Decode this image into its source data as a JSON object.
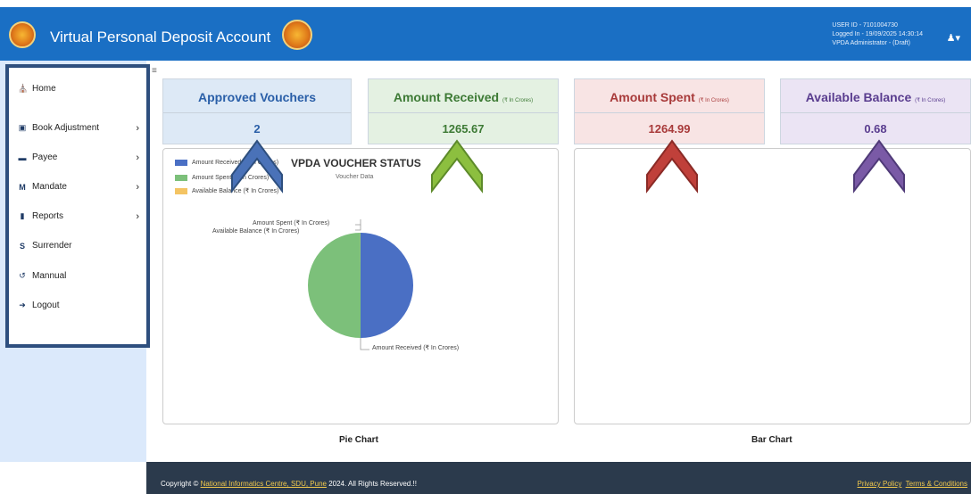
{
  "header": {
    "title": "Virtual Personal Deposit Account",
    "user_id": "USER ID - 7101004730",
    "logged_in": "Logged In - 19/09/2025 14:30:14",
    "role": "VPDA Administrator  -  (Draft)"
  },
  "sidebar": {
    "items": [
      {
        "label": "Home",
        "icon": "home-icon"
      },
      {
        "label": "Book Adjustment",
        "icon": "book-icon"
      },
      {
        "label": "Payee",
        "icon": "payee-icon"
      },
      {
        "label": "Mandate",
        "icon": "mandate-icon"
      },
      {
        "label": "Reports",
        "icon": "reports-icon"
      },
      {
        "label": "Surrender",
        "icon": "surrender-icon"
      },
      {
        "label": "Mannual",
        "icon": "manual-icon"
      },
      {
        "label": "Logout",
        "icon": "logout-icon"
      }
    ]
  },
  "cards": [
    {
      "title": "Approved Vouchers",
      "sub": "",
      "value": "2",
      "color": "#2a5fa8",
      "bg": "#dde9f6"
    },
    {
      "title": "Amount Received",
      "sub": "(₹ In Crores)",
      "value": "1265.67",
      "color": "#3d7a35",
      "bg": "#e4f1e2"
    },
    {
      "title": "Amount Spent",
      "sub": "(₹ In Crores)",
      "value": "1264.99",
      "color": "#a83a3a",
      "bg": "#f8e4e4"
    },
    {
      "title": "Available Balance",
      "sub": "(₹ In Crores)",
      "value": "0.68",
      "color": "#5a3d8f",
      "bg": "#ebe4f4"
    }
  ],
  "pie": {
    "title": "VPDA VOUCHER STATUS",
    "subtitle": "Voucher Data",
    "caption": "Pie Chart",
    "legend": [
      {
        "label": "Amount Received (₹ In Crores)",
        "color": "#4a6fc4"
      },
      {
        "label": "Amount Spent (₹ In Crores)",
        "color": "#7cc07a"
      },
      {
        "label": "Available Balance (₹ In Crores)",
        "color": "#f4c463"
      }
    ],
    "labels": {
      "spent": "Amount Spent (₹ In Crores)",
      "balance": "Available Balance (₹ In Crores)",
      "received": "Amount Received (₹ In Crores)"
    }
  },
  "bar": {
    "caption": "Bar Chart"
  },
  "chart_data": {
    "type": "pie",
    "title": "VPDA VOUCHER STATUS",
    "subtitle": "Voucher Data",
    "categories": [
      "Amount Received (₹ In Crores)",
      "Amount Spent (₹ In Crores)",
      "Available Balance (₹ In Crores)"
    ],
    "values": [
      1265.67,
      1264.99,
      0.68
    ],
    "colors": [
      "#4a6fc4",
      "#7cc07a",
      "#f4c463"
    ],
    "legend_position": "top-left"
  },
  "footer": {
    "prefix": "Copyright © ",
    "org": "National Informatics Centre, SDU, Pune",
    "suffix": " 2024. All Rights Reserved.!!",
    "privacy": "Privacy Policy",
    "terms": "Terms & Conditions"
  },
  "arrows": [
    {
      "fill": "#4a72b8",
      "stroke": "#2e4f7e"
    },
    {
      "fill": "#8cbf3f",
      "stroke": "#5d8a2a"
    },
    {
      "fill": "#c0403a",
      "stroke": "#8a2a26"
    },
    {
      "fill": "#7a5aa6",
      "stroke": "#4f3a78"
    }
  ]
}
